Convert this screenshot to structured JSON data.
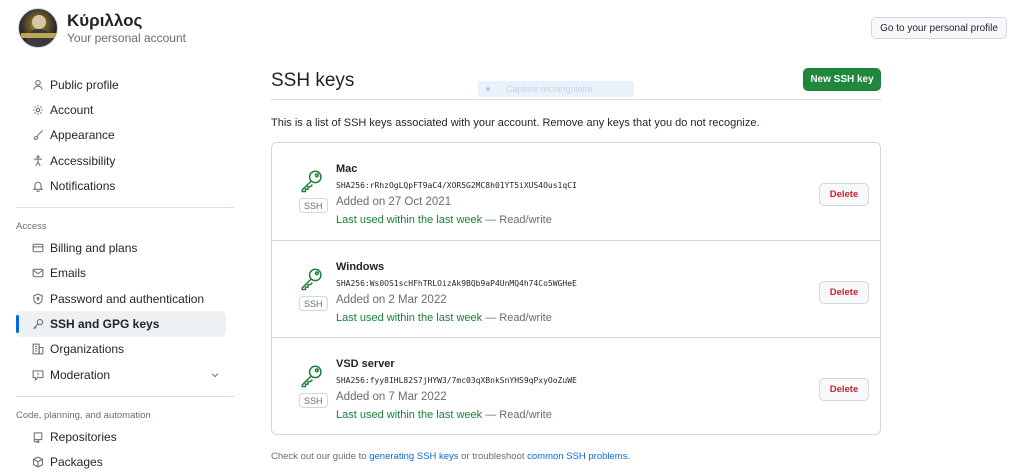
{
  "account": {
    "name": "Κύριλλος",
    "subtitle": "Your personal account",
    "profile_button": "Go to your personal profile"
  },
  "sidebar": {
    "items": [
      {
        "label": "Public profile",
        "icon": "person-icon"
      },
      {
        "label": "Account",
        "icon": "gear-icon"
      },
      {
        "label": "Appearance",
        "icon": "paintbrush-icon"
      },
      {
        "label": "Accessibility",
        "icon": "accessibility-icon"
      },
      {
        "label": "Notifications",
        "icon": "bell-icon"
      }
    ],
    "access_heading": "Access",
    "access_items": [
      {
        "label": "Billing and plans",
        "icon": "credit-card-icon"
      },
      {
        "label": "Emails",
        "icon": "mail-icon"
      },
      {
        "label": "Password and authentication",
        "icon": "shield-lock-icon"
      },
      {
        "label": "SSH and GPG keys",
        "icon": "key-icon",
        "active": true
      },
      {
        "label": "Organizations",
        "icon": "organization-icon"
      },
      {
        "label": "Moderation",
        "icon": "report-icon"
      }
    ],
    "code_heading": "Code, planning, and automation",
    "code_items": [
      {
        "label": "Repositories",
        "icon": "repo-icon"
      },
      {
        "label": "Packages",
        "icon": "package-icon"
      }
    ]
  },
  "main": {
    "title": "SSH keys",
    "new_button": "New SSH key",
    "capture_overlay": "Capture rectangulaire",
    "description": "This is a list of SSH keys associated with your account. Remove any keys that you do not recognize.",
    "badge": "SSH",
    "delete_label": "Delete",
    "keys": [
      {
        "name": "Mac",
        "fingerprint": "SHA256:rRhzOgLQpFT9aC4/XOR5G2MC8h01YT5iXUS4Ous1qCI",
        "added": "Added on 27 Oct 2021",
        "last_used": "Last used within the last week",
        "access": " — Read/write"
      },
      {
        "name": "Windows",
        "fingerprint": "SHA256:Ws0OS1scHFhTRLOizAk9BQb9aP4UnMQ4h74Co5WGHeE",
        "added": "Added on 2 Mar 2022",
        "last_used": "Last used within the last week",
        "access": " — Read/write"
      },
      {
        "name": "VSD server",
        "fingerprint": "SHA256:fyy8IHL82S7jHYW3/7mc03qXBnkSnYHS9qPxyOoZuWE",
        "added": "Added on 7 Mar 2022",
        "last_used": "Last used within the last week",
        "access": " — Read/write"
      }
    ],
    "footer": {
      "prefix": "Check out our guide to ",
      "link1": "generating SSH keys",
      "middle": " or troubleshoot ",
      "link2": "common SSH problems",
      "suffix": "."
    }
  },
  "colors": {
    "accent": "#0969da",
    "success": "#1f883d",
    "danger": "#cf222e"
  }
}
